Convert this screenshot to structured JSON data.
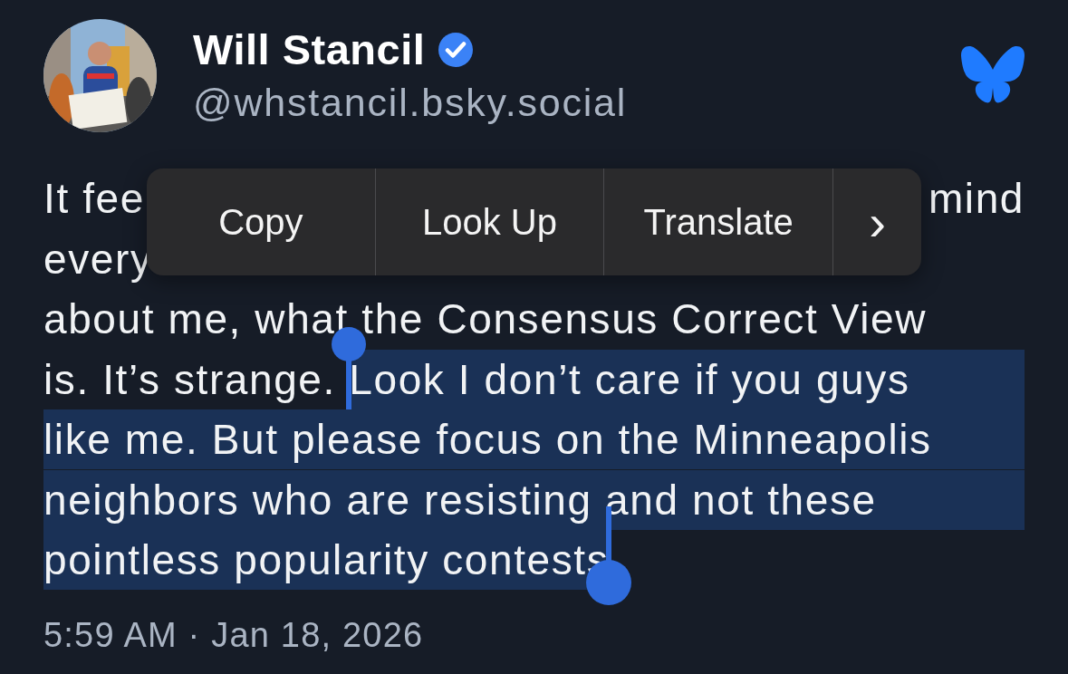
{
  "author": {
    "name": "Will Stancil",
    "verified": true,
    "handle": "@whstancil.bsky.social"
  },
  "post_lines": [
    {
      "kind": "covered",
      "segments": [
        {
          "text": "It fee",
          "selected": false
        },
        {
          "text": "mind",
          "selected": false
        }
      ]
    },
    {
      "kind": "covered",
      "segments": [
        {
          "text": "every",
          "selected": false
        }
      ]
    },
    {
      "kind": "plain",
      "segments": [
        {
          "text": "about me, what the Consensus Correct View",
          "selected": false
        }
      ]
    },
    {
      "kind": "plain",
      "segments": [
        {
          "text": "is. It’s strange. ",
          "selected": false
        },
        {
          "text": "Look I don’t care if you guys",
          "selected": true
        }
      ]
    },
    {
      "kind": "plain",
      "segments": [
        {
          "text": "like me. But please focus on the Minneapolis",
          "selected": true
        }
      ]
    },
    {
      "kind": "plain",
      "segments": [
        {
          "text": "neighbors who are resisting and not these",
          "selected": true
        }
      ]
    },
    {
      "kind": "plain",
      "segments": [
        {
          "text": "pointless popularity contests",
          "selected": true
        }
      ]
    }
  ],
  "context_menu": [
    {
      "kind": "text",
      "label": "Copy"
    },
    {
      "kind": "text",
      "label": "Look Up"
    },
    {
      "kind": "text",
      "label": "Translate"
    },
    {
      "kind": "more",
      "label": "›"
    }
  ],
  "timestamp": "5:59 AM · Jan 18, 2026"
}
